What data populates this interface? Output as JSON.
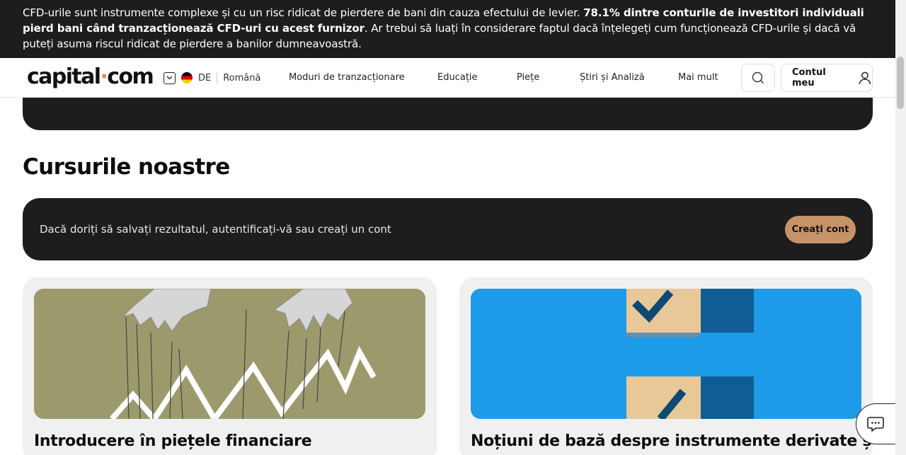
{
  "risk_warning": {
    "text_part1": "CFD-urile sunt instrumente complexe și cu un risc ridicat de pierdere de bani din cauza efectului de levier. ",
    "text_bold": "78.1% dintre conturile de investitori individuali pierd bani când tranzacționează CFD-uri cu acest furnizor",
    "text_part2": ". Ar trebui să luați în considerare faptul dacă înțelegeți cum funcționează CFD-urile și dacă vă puteți asuma riscul ridicat de pierdere a banilor dumneavoastră."
  },
  "header": {
    "logo_left": "capital",
    "logo_dot": "·",
    "logo_right": "com",
    "lang_code": "DE",
    "lang_name": "Română",
    "nav": [
      "Moduri de tranzacționare",
      "Educație",
      "Piețe",
      "Știri și Analiză",
      "Mai mult"
    ],
    "account_label": "Contul meu"
  },
  "main": {
    "section_title": "Cursurile noastre",
    "cta_text": "Dacă doriți să salvați rezultatul, autentificați-vă sau creați un cont",
    "cta_button": "Creați cont",
    "cards": [
      {
        "title": "Introducere în piețele financiare"
      },
      {
        "title": "Noțiuni de bază despre instrumente derivate și"
      }
    ]
  },
  "colors": {
    "dark": "#1d1d1d",
    "accent": "#c69369",
    "card_bg": "#f0f0f0"
  }
}
